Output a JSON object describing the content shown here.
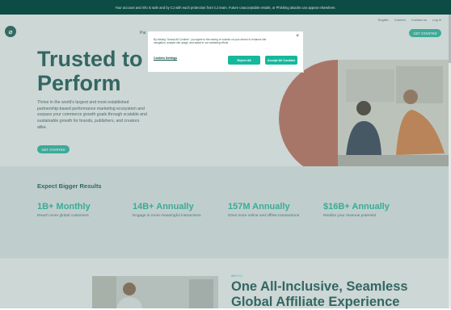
{
  "banner": {
    "text": "Your account and info is safe and by CJ with each protection from CJ team. Future unacceptable emails, or Phishing attacks can appear elsewhere."
  },
  "nav": {
    "trunc": "Par",
    "links": [
      "English",
      "Careers",
      "Contact us",
      "Log in"
    ],
    "cta": "GET STARTED"
  },
  "hero": {
    "headline": "Trusted to\nPerform",
    "body": "Thrive in the world's largest and most established partnership-based performance marketing ecosystem and surpass your commerce growth goals through scalable and sustainable growth for brands, publishers, and creators alike.",
    "cta": "GET STARTED"
  },
  "results": {
    "title": "Expect Bigger Results",
    "stats": [
      {
        "value": "1B+ Monthly",
        "desc": "Reach more global customers"
      },
      {
        "value": "14B+ Annually",
        "desc": "Engage in more meaningful interactions"
      },
      {
        "value": "157M Annually",
        "desc": "Drive more online and offline transactions"
      },
      {
        "value": "$16B+ Annually",
        "desc": "Realize your revenue potential"
      }
    ]
  },
  "lower": {
    "eyebrow": "WHY CJ",
    "title": "One All-Inclusive, Seamless\nGlobal Affiliate Experience"
  },
  "cookie": {
    "text": "By clicking \"Accept All Cookies\", you agree to the storing of cookies on your device to enhance site navigation, analyze site usage, and assist in our marketing efforts.",
    "settings": "Cookies Settings",
    "reject": "Reject All",
    "accept": "Accept All Cookies",
    "close": "×"
  },
  "colors": {
    "brand": "#0b4a44",
    "accent": "#16b89b",
    "terracotta": "#c6634e"
  }
}
